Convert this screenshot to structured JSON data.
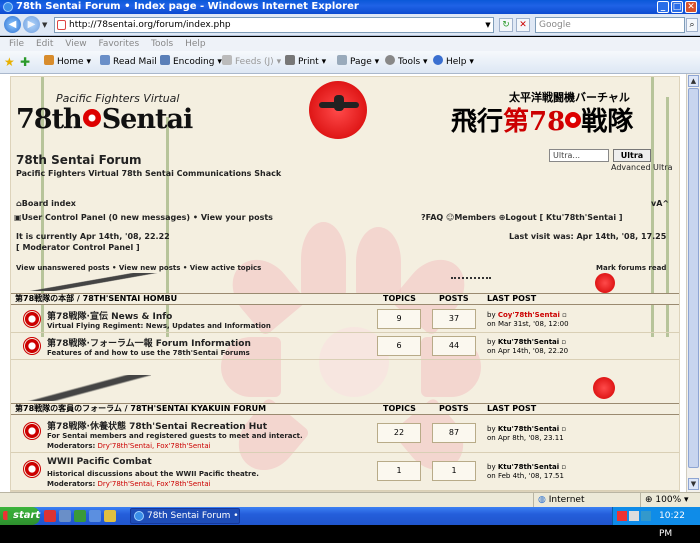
{
  "window": {
    "title": "78th Sentai Forum • Index page - Windows Internet Explorer",
    "min": "_",
    "max": "□",
    "close": "✕"
  },
  "address": {
    "url": "http://78sentai.org/forum/index.php",
    "search_placeholder": "Google"
  },
  "menu": [
    "File",
    "Edit",
    "View",
    "Favorites",
    "Tools",
    "Help"
  ],
  "toolbar": {
    "home": "Home",
    "read_mail": "Read Mail",
    "encoding": "Encoding",
    "feeds": "Feeds (J)",
    "print": "Print",
    "page": "Page",
    "tools": "Tools",
    "help": "Help"
  },
  "header": {
    "logo_en_sub": "Pacific Fighters Virtual",
    "logo_en_left": "78th",
    "logo_en_right": "Sentai",
    "logo_jp_sub": "太平洋戦闘機バーチャル",
    "logo_jp_a": "飛行",
    "logo_jp_b": "第78",
    "logo_jp_c": "戦隊",
    "site_title": "78th Sentai Forum",
    "site_desc": "Pacific Fighters Virtual 78th Sentai Communications Shack",
    "search_value": "Ultra...",
    "search_button": "Ultra",
    "advanced": "Advanced Ultra"
  },
  "nav": {
    "board_index": "Board index",
    "font_ctrl": "vA^",
    "ucp": "User Control Panel (0 new messages)",
    "sep": "•",
    "view_posts": "View your posts",
    "faq": "FAQ",
    "members": "Members",
    "logout": "Logout [ Ktu'78th'Sentai ]",
    "current_time": "It is currently Apr 14th, '08, 22.22",
    "last_visit": "Last visit was: Apr 14th, '08, 17.25",
    "mcp": "[ Moderator Control Panel ]",
    "view_unanswered": "View unanswered posts",
    "view_new": "View new posts",
    "view_active": "View active topics",
    "mark_read": "Mark forums read"
  },
  "columns": {
    "topics": "TOPICS",
    "posts": "POSTS",
    "last_post": "LAST POST"
  },
  "categories": [
    {
      "title": "第78戦隊の本部 / 78TH'SENTAI HOMBU",
      "forums": [
        {
          "name": "第78戦隊·宣伝   News & Info",
          "desc": "Virtual Flying Regiment: News, Updates and Information",
          "mods_label": "",
          "mods": "",
          "topics": "9",
          "posts": "37",
          "by": "Coy'78th'Sentai",
          "date": "on Mar 31st, '08, 12:00"
        },
        {
          "name": "第78戦隊·フォーラム一報   Forum Information",
          "desc": "Features of and how to use the 78th'Sentai Forums",
          "mods_label": "",
          "mods": "",
          "topics": "6",
          "posts": "44",
          "by": "Ktu'78th'Sentai",
          "date": "on Apr 14th, '08, 22.20"
        }
      ]
    },
    {
      "title": "第78戦隊の客員のフォーラム / 78TH'SENTAI KYAKUIN FORUM",
      "forums": [
        {
          "name": "第78戦隊·休養状態   78th'Sentai Recreation Hut",
          "desc": "For Sentai members and registered guests to meet and interact.",
          "mods_label": "Moderators:",
          "mods": "Dry'78th'Sentai, Fox'78th'Sentai",
          "topics": "22",
          "posts": "87",
          "by": "Ktu'78th'Sentai",
          "date": "on Apr 8th, '08, 23.11"
        },
        {
          "name": "WWII Pacific Combat",
          "desc": "Historical discussions about the WWII Pacific theatre.",
          "mods_label": "Moderators:",
          "mods": "Dry'78th'Sentai, Fox'78th'Sentai",
          "topics": "1",
          "posts": "1",
          "by": "Ktu'78th'Sentai",
          "date": "on Feb 4th, '08, 17.51"
        }
      ]
    }
  ],
  "status": {
    "zone": "Internet",
    "zoom": "100%"
  },
  "taskbar": {
    "start": "start",
    "task": "78th Sentai Forum • I...",
    "clock": "10:22 PM"
  }
}
